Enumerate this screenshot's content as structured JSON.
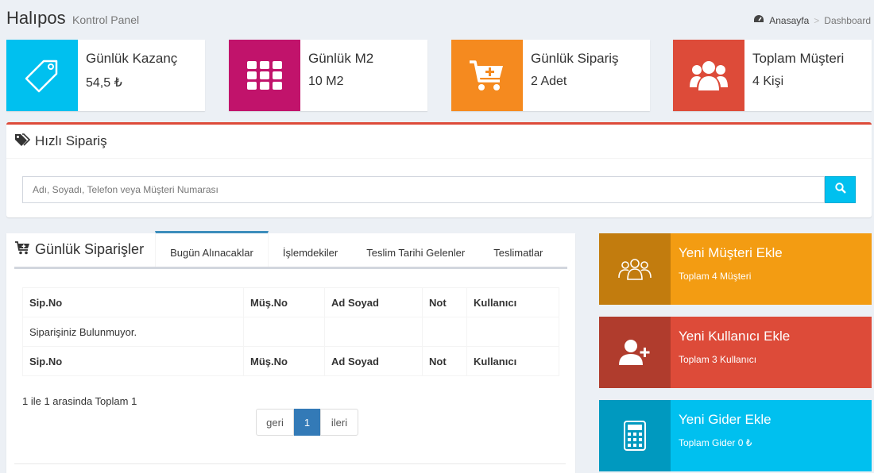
{
  "header": {
    "title": "Halıpos",
    "subtitle": "Kontrol Panel"
  },
  "breadcrumb": {
    "home": "Anasayfa",
    "current": "Dashboard"
  },
  "stats": [
    {
      "label": "Günlük Kazanç",
      "value": "54,5 ₺",
      "color": "#00c0ef",
      "icon": "tag-icon"
    },
    {
      "label": "Günlük M2",
      "value": "10 M2",
      "color": "#c1136b",
      "icon": "grid-icon"
    },
    {
      "label": "Günlük Sipariş",
      "value": "2 Adet",
      "color": "#f58a1f",
      "icon": "cart-plus-icon"
    },
    {
      "label": "Toplam Müşteri",
      "value": "4 Kişi",
      "color": "#dd4b39",
      "icon": "users-icon"
    }
  ],
  "quick_order": {
    "title": "Hızlı Sipariş",
    "placeholder": "Adı, Soyadı, Telefon veya Müşteri Numarası"
  },
  "orders": {
    "title": "Günlük Siparişler",
    "tabs": [
      "Bugün Alınacaklar",
      "İşlemdekiler",
      "Teslim Tarihi Gelenler",
      "Teslimatlar"
    ],
    "columns": [
      "Sip.No",
      "Müş.No",
      "Ad Soyad",
      "Not",
      "Kullanıcı"
    ],
    "empty_message": "Siparişiniz Bulunmuyor.",
    "summary": "1 ile 1 arasinda Toplam 1",
    "pager": {
      "prev": "geri",
      "current": "1",
      "next": "ileri"
    }
  },
  "actions": [
    {
      "title": "Yeni Müşteri Ekle",
      "sub": "Toplam 4 Müşteri",
      "color": "#f39c12",
      "icon": "users-outline-icon"
    },
    {
      "title": "Yeni Kullanıcı Ekle",
      "sub": "Toplam 3 Kullanıcı",
      "color": "#dd4b39",
      "icon": "user-plus-icon"
    },
    {
      "title": "Yeni Gider Ekle",
      "sub": "Toplam Gider 0 ₺",
      "color": "#00c0ef",
      "icon": "calculator-icon"
    }
  ]
}
